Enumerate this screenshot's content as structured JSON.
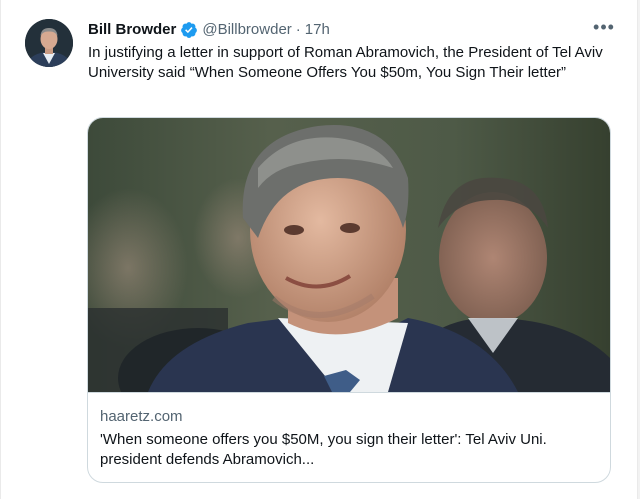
{
  "tweet": {
    "author_name": "Bill Browder",
    "handle": "@Billbrowder",
    "separator": "·",
    "time": "17h",
    "more_label": "•••",
    "text": "In justifying a letter in support of Roman Abramovich, the President of Tel Aviv University said “When Someone Offers You $50m, You Sign Their letter”",
    "verified_color": "#1d9bf0",
    "avatar_icon": "profile-photo",
    "card": {
      "domain": "haaretz.com",
      "title": "'When someone offers you $50M, you sign their letter': Tel Aviv Uni. president defends Abramovich..."
    }
  }
}
